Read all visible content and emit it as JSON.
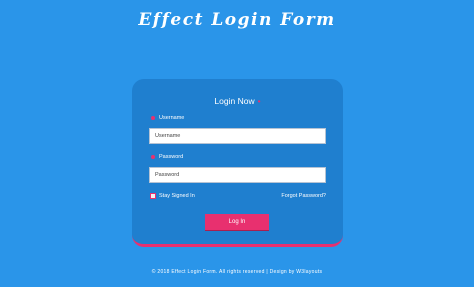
{
  "page": {
    "title": "Effect Login Form"
  },
  "card": {
    "title": "Login Now",
    "title_mark": "•"
  },
  "username": {
    "label": "Username",
    "placeholder": "Username"
  },
  "password": {
    "label": "Password",
    "placeholder": "Password"
  },
  "remember": {
    "label": "Stay Signed In",
    "checked": false
  },
  "forgot": {
    "label": "Forgot Password?"
  },
  "login_button": {
    "label": "Log In"
  },
  "footer": {
    "text": "© 2018 Effect Login Form. All rights reserved | Design by W3layouts"
  },
  "colors": {
    "background": "#2a95e9",
    "card": "#1f7fcf",
    "accent": "#e8306f"
  }
}
